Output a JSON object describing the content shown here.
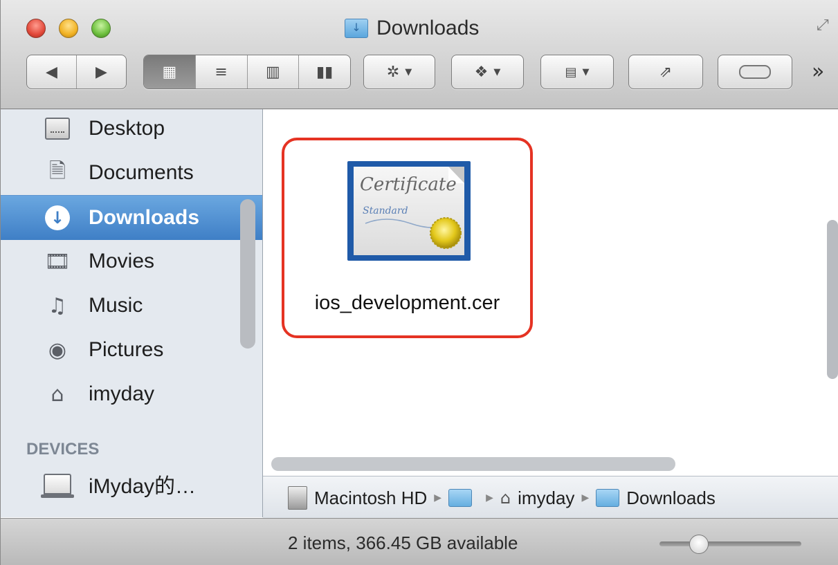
{
  "window": {
    "title": "Downloads"
  },
  "toolbar": {
    "back_icon": "back-arrow-icon",
    "forward_icon": "forward-arrow-icon",
    "view_modes": [
      "icon-view",
      "list-view",
      "column-view",
      "coverflow-view"
    ],
    "action_icon": "gear-icon",
    "dropbox_icon": "dropbox-icon",
    "arrange_icon": "arrange-icon",
    "share_icon": "share-icon",
    "toggle_icon": "toggle-pill-icon"
  },
  "sidebar": {
    "items": [
      {
        "label": "Desktop",
        "icon": "desktop-icon"
      },
      {
        "label": "Documents",
        "icon": "documents-icon"
      },
      {
        "label": "Downloads",
        "icon": "downloads-icon",
        "selected": true
      },
      {
        "label": "Movies",
        "icon": "movies-icon"
      },
      {
        "label": "Music",
        "icon": "music-icon"
      },
      {
        "label": "Pictures",
        "icon": "pictures-icon"
      },
      {
        "label": "imyday",
        "icon": "home-icon"
      }
    ],
    "devices_heading": "DEVICES",
    "devices": [
      {
        "label": "iMyday的…",
        "icon": "laptop-icon"
      }
    ]
  },
  "content": {
    "files": [
      {
        "name": "ios_development.cer",
        "icon": "certificate-icon",
        "highlighted": true
      }
    ],
    "certificate_art": {
      "line1": "Certificate",
      "line2": "Standard"
    }
  },
  "pathbar": {
    "segments": [
      "Macintosh HD",
      "",
      "imyday",
      "Downloads"
    ]
  },
  "status": {
    "text": "2 items, 366.45 GB available"
  },
  "colors": {
    "highlight_border": "#e53323",
    "selection": "#3f7fc6"
  }
}
